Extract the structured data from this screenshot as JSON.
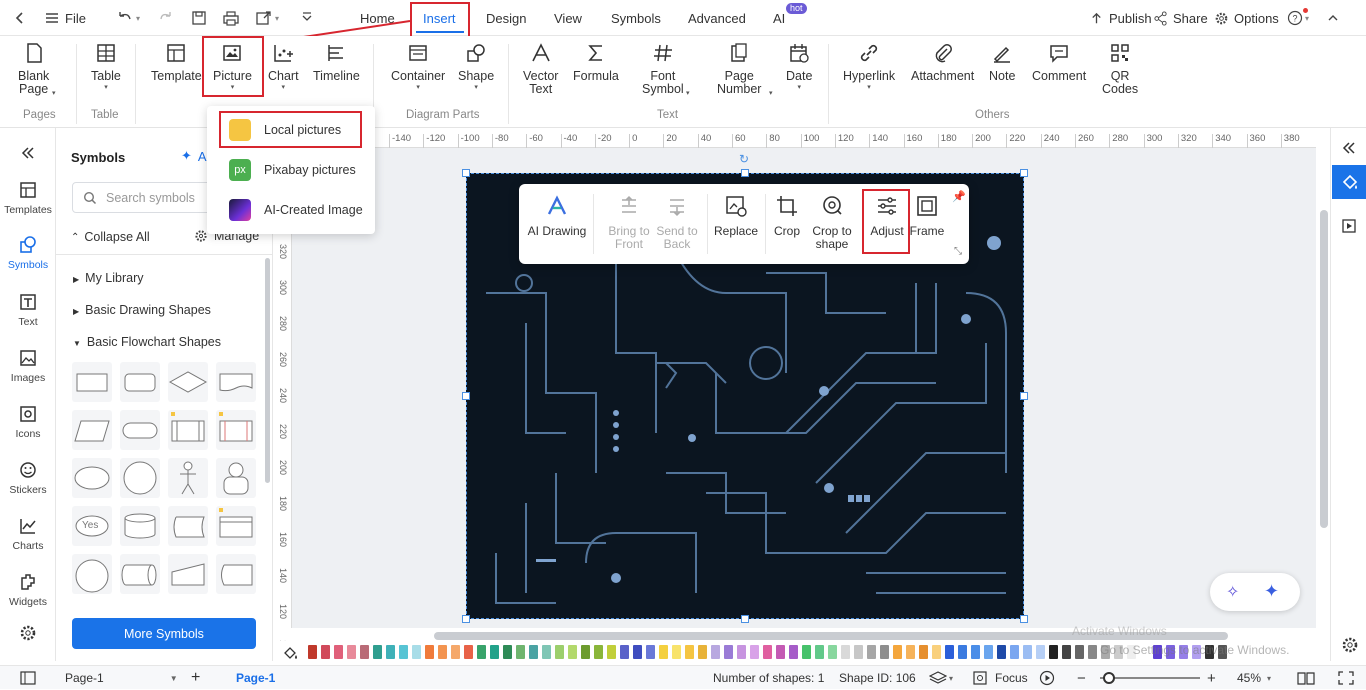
{
  "topbar": {
    "file": "File",
    "tabs": [
      "Home",
      "Insert",
      "Design",
      "View",
      "Symbols",
      "Advanced",
      "AI"
    ],
    "ai_badge": "hot",
    "publish": "Publish",
    "share": "Share",
    "options": "Options"
  },
  "ribbon": {
    "blank_page": [
      "Blank",
      "Page"
    ],
    "table": "Table",
    "template": "Template",
    "picture": "Picture",
    "chart": "Chart",
    "timeline": "Timeline",
    "container": "Container",
    "shape": "Shape",
    "vector_text": [
      "Vector",
      "Text"
    ],
    "formula": "Formula",
    "font_symbol": [
      "Font",
      "Symbol"
    ],
    "page_number": [
      "Page",
      "Number"
    ],
    "date": "Date",
    "hyperlink": "Hyperlink",
    "attachment": "Attachment",
    "note": "Note",
    "comment": "Comment",
    "qr_codes": [
      "QR",
      "Codes"
    ],
    "groups": {
      "pages": "Pages",
      "table": "Table",
      "diagram_parts": "Diagram Parts",
      "text": "Text",
      "others": "Others"
    }
  },
  "picture_menu": {
    "items": [
      "Local pictures",
      "Pixabay pictures",
      "AI-Created Image"
    ],
    "px_icon": "px"
  },
  "rail": {
    "items": [
      "Templates",
      "Symbols",
      "Text",
      "Images",
      "Icons",
      "Stickers",
      "Charts",
      "Widgets"
    ]
  },
  "symbols_panel": {
    "title": "Symbols",
    "ai_label": "A",
    "search_placeholder": "Search symbols",
    "collapse_all": "Collapse All",
    "manage": "Manage",
    "sections": [
      "My Library",
      "Basic Drawing Shapes",
      "Basic Flowchart Shapes"
    ],
    "yes_shape": "Yes",
    "more_symbols": "More Symbols"
  },
  "ruler": {
    "h_ticks": [
      "-140",
      "-120",
      "-100",
      "-80",
      "-60",
      "-40",
      "-20",
      "0",
      "20",
      "40",
      "60",
      "80",
      "100",
      "120",
      "140",
      "160",
      "180",
      "200",
      "220",
      "240",
      "260",
      "280",
      "300",
      "320",
      "340",
      "360",
      "380"
    ],
    "v_ticks": [
      "320",
      "300",
      "280",
      "260",
      "240",
      "220",
      "200",
      "180",
      "160",
      "140",
      "120",
      "100"
    ]
  },
  "floatbar": {
    "items": [
      {
        "label": [
          "AI Drawing"
        ],
        "disabled": false
      },
      {
        "label": [
          "Bring to",
          "Front"
        ],
        "disabled": true
      },
      {
        "label": [
          "Send to",
          "Back"
        ],
        "disabled": true
      },
      {
        "label": [
          "Replace"
        ],
        "disabled": false
      },
      {
        "label": [
          "Crop"
        ],
        "disabled": false
      },
      {
        "label": [
          "Crop to",
          "shape"
        ],
        "disabled": false
      },
      {
        "label": [
          "Adjust"
        ],
        "disabled": false
      },
      {
        "label": [
          "Frame"
        ],
        "disabled": false
      }
    ]
  },
  "statusbar": {
    "page_select": "Page-1",
    "page_tab": "Page-1",
    "num_shapes": "Number of shapes: 1",
    "shape_id": "Shape ID: 106",
    "focus": "Focus",
    "zoom": "45%"
  },
  "watermark": [
    "Activate Windows",
    "Go to Settings to activate Windows."
  ],
  "colors": {
    "accent": "#1a6fe8",
    "highlight": "#d7262f",
    "canvas_image": "#0b1520",
    "palette": [
      "#c0392b",
      "#d14a5b",
      "#e0607a",
      "#e88a9a",
      "#b96b77",
      "#2f9e8f",
      "#3fb1b8",
      "#57c4d4",
      "#a8dde8",
      "#f07b3b",
      "#f39450",
      "#f5a86a",
      "#e86248",
      "#38a36b",
      "#22a28a",
      "#2e8b57",
      "#6fb56f",
      "#4aa3a3",
      "#7fc6b5",
      "#9ccf6c",
      "#b3d96c",
      "#6d9c2e",
      "#8ab63a",
      "#c1cf3a",
      "#5a62c9",
      "#3f4dbf",
      "#6a78d8",
      "#f4d03f",
      "#f8e36b",
      "#f5c542",
      "#e8b339",
      "#b8a8e0",
      "#9a7bd6",
      "#c794e0",
      "#d8a2e8",
      "#e05fa0",
      "#c45ab4",
      "#a65cc8",
      "#47c26b",
      "#62c98a",
      "#88d79e",
      "#d9d9d9",
      "#c7c7c7",
      "#a6a6a6",
      "#8e8e8e",
      "#f4a63c",
      "#f6b35a",
      "#e68f2e",
      "#f9d07c",
      "#2b5fd9",
      "#3b7be0",
      "#4b8ee8",
      "#6aa5ee",
      "#1e4aa8",
      "#7aa6f0",
      "#9bbdf3",
      "#b6cff6",
      "#222222",
      "#444444",
      "#666666",
      "#888888",
      "#aaaaaa",
      "#cccccc",
      "#eeeeee",
      "#ffffff",
      "#5d3fd3",
      "#7b61e0",
      "#967fe8",
      "#b19ff0",
      "#333333",
      "#555555"
    ]
  }
}
